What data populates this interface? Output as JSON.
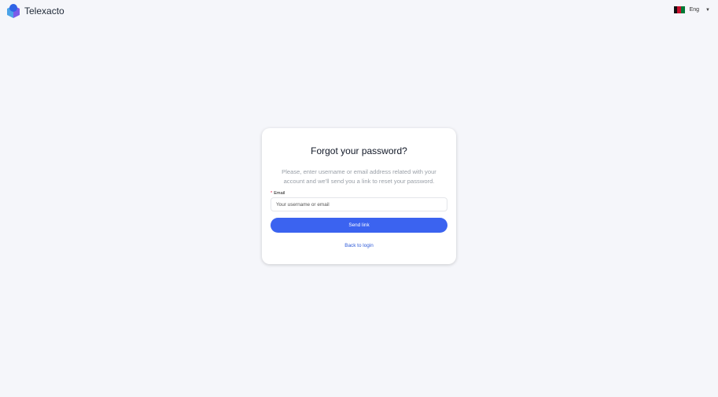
{
  "header": {
    "brand": "Telexacto",
    "language": "Eng",
    "flag_colors": [
      "#111111",
      "#c8102e",
      "#007a36"
    ]
  },
  "form": {
    "title": "Forgot your password?",
    "description": "Please, enter username or email address related with your account and we'll send you a link to reset your password.",
    "required_mark": "*",
    "email_label": "Email",
    "email_placeholder": "Your username or email",
    "submit_label": "Send link",
    "back_label": "Back to login"
  },
  "colors": {
    "primary": "#3b63f0",
    "link": "#2f5bd8",
    "background": "#f5f6fa"
  }
}
